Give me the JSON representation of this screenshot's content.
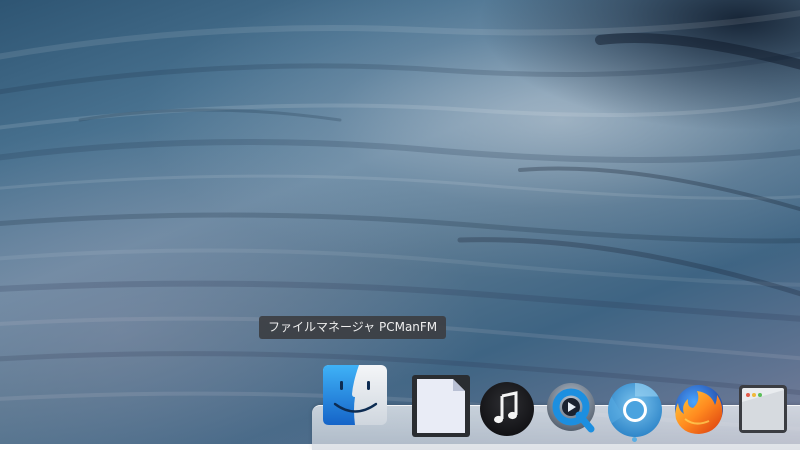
{
  "screen": {
    "name": "desktop-with-dock"
  },
  "tooltip": {
    "text": "ファイルマネージャ PCManFM"
  },
  "dock": {
    "items": [
      {
        "name": "file-manager",
        "icon": "finder-face-icon",
        "hovered": true
      },
      {
        "name": "document-viewer",
        "icon": "blank-document-icon"
      },
      {
        "name": "music-player",
        "icon": "music-note-icon"
      },
      {
        "name": "media-player",
        "icon": "quicktime-icon"
      },
      {
        "name": "web-browser",
        "icon": "chromium-icon",
        "running": true
      },
      {
        "name": "firefox",
        "icon": "firefox-icon"
      },
      {
        "name": "app-window",
        "icon": "window-icon"
      }
    ]
  },
  "colors": {
    "tooltip_bg": "#3c3e42",
    "tooltip_text": "#eeeeee",
    "finder_blue": "#1e88e5",
    "chromium_blue": "#4aa3df"
  }
}
